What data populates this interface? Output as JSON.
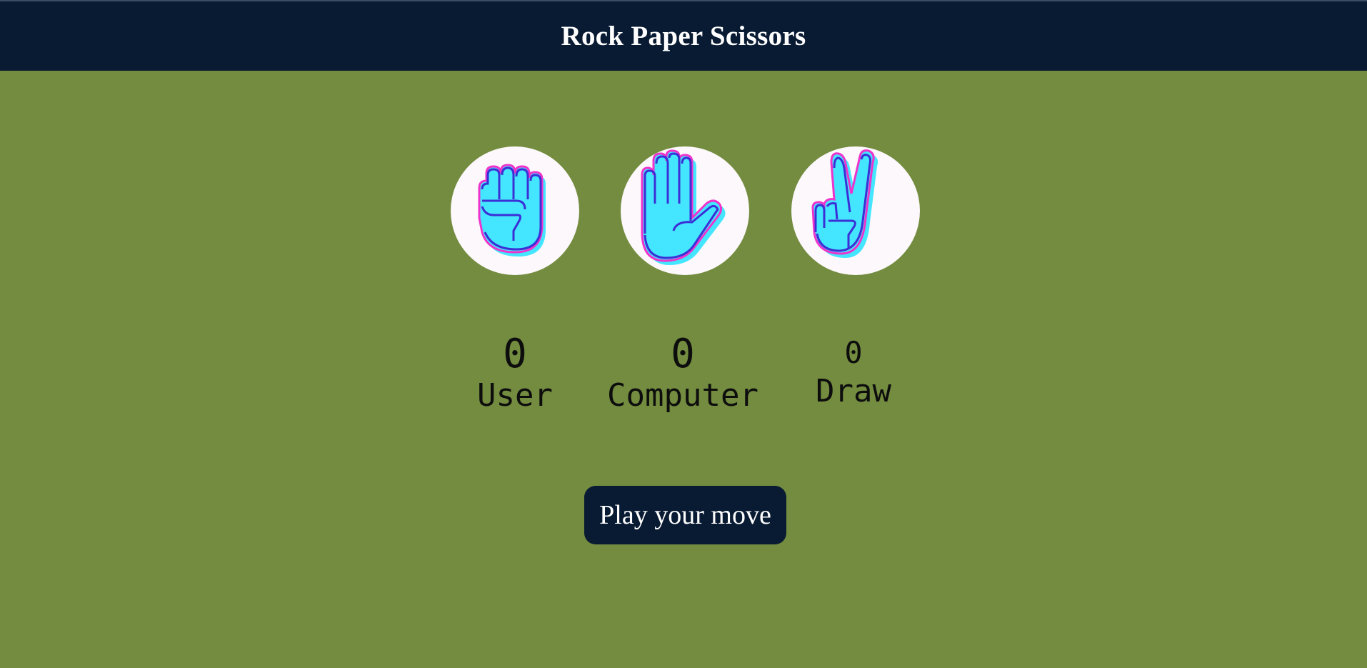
{
  "header": {
    "title": "Rock Paper Scissors"
  },
  "choices": [
    {
      "id": "rock",
      "icon": "fist-icon"
    },
    {
      "id": "paper",
      "icon": "open-hand-icon"
    },
    {
      "id": "scissors",
      "icon": "peace-hand-icon"
    }
  ],
  "scores": {
    "user": {
      "value": "0",
      "label": "User"
    },
    "computer": {
      "value": "0",
      "label": "Computer"
    },
    "draw": {
      "value": "0",
      "label": "Draw"
    }
  },
  "message": {
    "label": "Play your move"
  },
  "colors": {
    "background": "#738c3f",
    "header": "#091b33",
    "hand_fill": "#44e6ff",
    "hand_outline": "#3b2fd6",
    "hand_accent": "#ee33cc",
    "circle": "#fdf8fc"
  }
}
